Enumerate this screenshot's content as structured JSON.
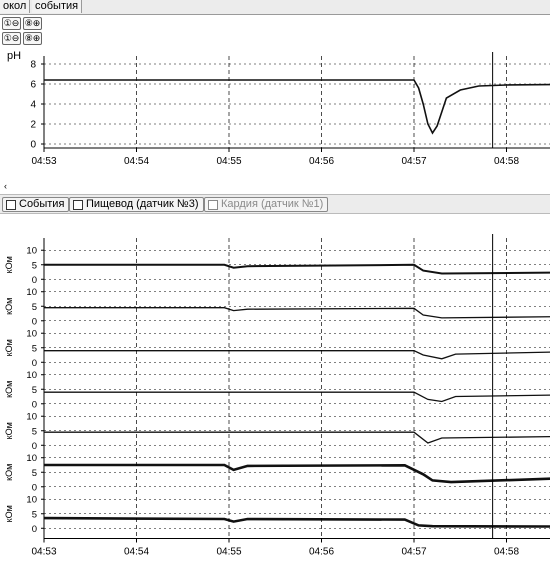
{
  "tabs": [
    "окол",
    "события"
  ],
  "toolbar": {
    "b1": "①⊖",
    "b2": "⑧⊕",
    "b3": "①⊖",
    "b4": "⑧⊕"
  },
  "ph_panel": {
    "ylabel": "pH",
    "yticks": [
      "8",
      "6",
      "4",
      "2",
      "0"
    ],
    "xticks": [
      "04:53",
      "04:54",
      "04:55",
      "04:56",
      "04:57",
      "04:58"
    ]
  },
  "scroll_arrow": "‹",
  "filters": {
    "events": "События",
    "esophagus": "Пищевод (датчик №3)",
    "cardia": "Кардия (датчик №1)"
  },
  "imp_panel": {
    "unit": "кОм",
    "yticks_full": [
      "10",
      "5",
      "0"
    ],
    "yticks_short": [
      "5",
      "0"
    ],
    "xticks": [
      "04:53",
      "04:54",
      "04:55",
      "04:56",
      "04:57",
      "04:58"
    ]
  },
  "chart_data": [
    {
      "type": "line",
      "ylabel": "pH",
      "ylim": [
        0,
        8
      ],
      "grid": true,
      "x": [
        "04:53",
        "04:54",
        "04:55",
        "04:56",
        "04:57",
        "04:58"
      ],
      "series": [
        {
          "values_sampled": [
            [
              0,
              6.4
            ],
            [
              4.0,
              6.4
            ],
            [
              4.05,
              5.6
            ],
            [
              4.1,
              4.0
            ],
            [
              4.15,
              2.0
            ],
            [
              4.2,
              1.1
            ],
            [
              4.25,
              1.8
            ],
            [
              4.35,
              4.6
            ],
            [
              4.5,
              5.4
            ],
            [
              4.7,
              5.8
            ],
            [
              5.0,
              5.9
            ],
            [
              5.5,
              5.95
            ]
          ]
        }
      ]
    },
    {
      "type": "line",
      "ylabel": "кОм",
      "ylim": [
        0,
        10
      ],
      "grid": true,
      "x": [
        "04:53",
        "04:54",
        "04:55",
        "04:56",
        "04:57",
        "04:58"
      ],
      "series": [
        {
          "values_sampled": [
            [
              0,
              5
            ],
            [
              1.95,
              5
            ],
            [
              2.05,
              4
            ],
            [
              2.2,
              4.5
            ],
            [
              4.0,
              5
            ],
            [
              4.1,
              3
            ],
            [
              4.3,
              2
            ],
            [
              5.5,
              2.3
            ]
          ]
        },
        {
          "values_sampled": [
            [
              0,
              4.5
            ],
            [
              1.95,
              4.5
            ],
            [
              2.05,
              3.5
            ],
            [
              2.2,
              4
            ],
            [
              4.0,
              4.3
            ],
            [
              4.1,
              2
            ],
            [
              4.3,
              1
            ],
            [
              5.5,
              1.4
            ]
          ]
        },
        {
          "values_sampled": [
            [
              0,
              4
            ],
            [
              4.0,
              4
            ],
            [
              4.1,
              2.5
            ],
            [
              4.3,
              1.2
            ],
            [
              4.45,
              2.8
            ],
            [
              5.5,
              3.5
            ]
          ]
        },
        {
          "values_sampled": [
            [
              0,
              4
            ],
            [
              4.0,
              4
            ],
            [
              4.15,
              1.5
            ],
            [
              4.3,
              0.8
            ],
            [
              4.45,
              2.5
            ],
            [
              5.5,
              3.0
            ]
          ]
        },
        {
          "values_sampled": [
            [
              0,
              4.5
            ],
            [
              4.0,
              4.5
            ],
            [
              4.15,
              0.8
            ],
            [
              4.3,
              2.5
            ],
            [
              5.5,
              3.0
            ]
          ]
        },
        {
          "values_sampled": [
            [
              0,
              7.5
            ],
            [
              1.95,
              7.5
            ],
            [
              2.05,
              5.8
            ],
            [
              2.2,
              7.2
            ],
            [
              3.9,
              7.4
            ],
            [
              4.1,
              4.3
            ],
            [
              4.2,
              2.2
            ],
            [
              4.4,
              1.6
            ],
            [
              5.5,
              2.8
            ]
          ]
        },
        {
          "values_sampled": [
            [
              0,
              3.5
            ],
            [
              1.95,
              3.2
            ],
            [
              2.05,
              2.3
            ],
            [
              2.2,
              3.2
            ],
            [
              3.9,
              3.0
            ],
            [
              4.05,
              1.0
            ],
            [
              4.2,
              0.7
            ],
            [
              5.5,
              0.6
            ]
          ]
        }
      ]
    }
  ],
  "colors": {
    "grid": "#000000",
    "trace": "#111111",
    "panel_bg": "#ffffff",
    "bar_bg": "#ececec"
  }
}
